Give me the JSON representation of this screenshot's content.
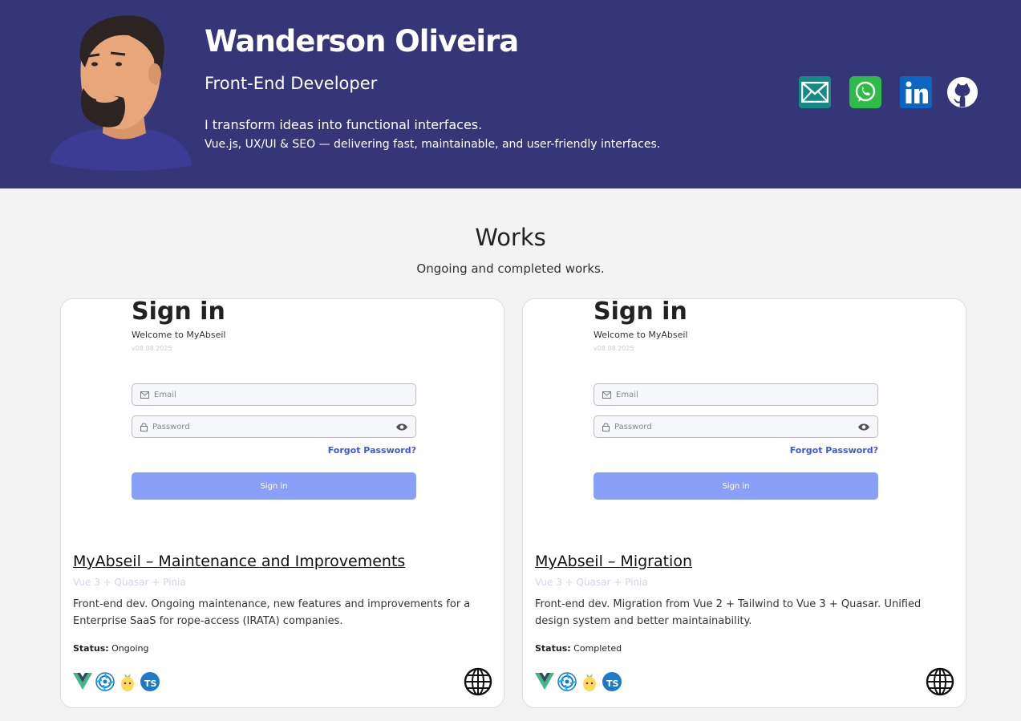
{
  "header": {
    "name": "Wanderson Oliveira",
    "role": "Front-End Developer",
    "tagline": "I transform ideas into functional interfaces.",
    "subtagline": "Vue.js, UX/UI & SEO — delivering fast, maintainable, and user-friendly interfaces.",
    "socials": [
      {
        "icon": "email-icon",
        "color": "#148a85"
      },
      {
        "icon": "whatsapp-icon",
        "color": "#2fbb47"
      },
      {
        "icon": "linkedin-icon",
        "color": "#0a66c2"
      },
      {
        "icon": "github-icon",
        "color": "#ffffff"
      }
    ],
    "bg_color": "#343677"
  },
  "works": {
    "title": "Works",
    "subtitle": "Ongoing and completed works.",
    "cards": [
      {
        "preview": {
          "title": "Sign in",
          "welcome": "Welcome to MyAbseil",
          "version": "v08.08.2025",
          "email_placeholder": "Email",
          "password_placeholder": "Password",
          "forgot": "Forgot Password?",
          "button": "Sign in"
        },
        "title": "MyAbseil – Maintenance and Improvements",
        "stack": "Vue 3 + Quasar + Pinia",
        "description": "Front-end dev. Ongoing maintenance, new features and improvements for a Enterprise SaaS for rope-access (IRATA) companies.",
        "status_label": "Status:",
        "status": "Ongoing",
        "tech_icons": [
          "vue-icon",
          "quasar-icon",
          "pinia-icon",
          "typescript-icon"
        ]
      },
      {
        "preview": {
          "title": "Sign in",
          "welcome": "Welcome to MyAbseil",
          "version": "v08.08.2025",
          "email_placeholder": "Email",
          "password_placeholder": "Password",
          "forgot": "Forgot Password?",
          "button": "Sign in"
        },
        "title": "MyAbseil – Migration",
        "stack": "Vue 3 + Quasar + Pinia",
        "description": "Front-end dev. Migration from Vue 2 + Tailwind to Vue 3 + Quasar. Unified design system and better maintainability.",
        "status_label": "Status:",
        "status": "Completed",
        "tech_icons": [
          "vue-icon",
          "quasar-icon",
          "pinia-icon",
          "typescript-icon"
        ]
      }
    ]
  }
}
